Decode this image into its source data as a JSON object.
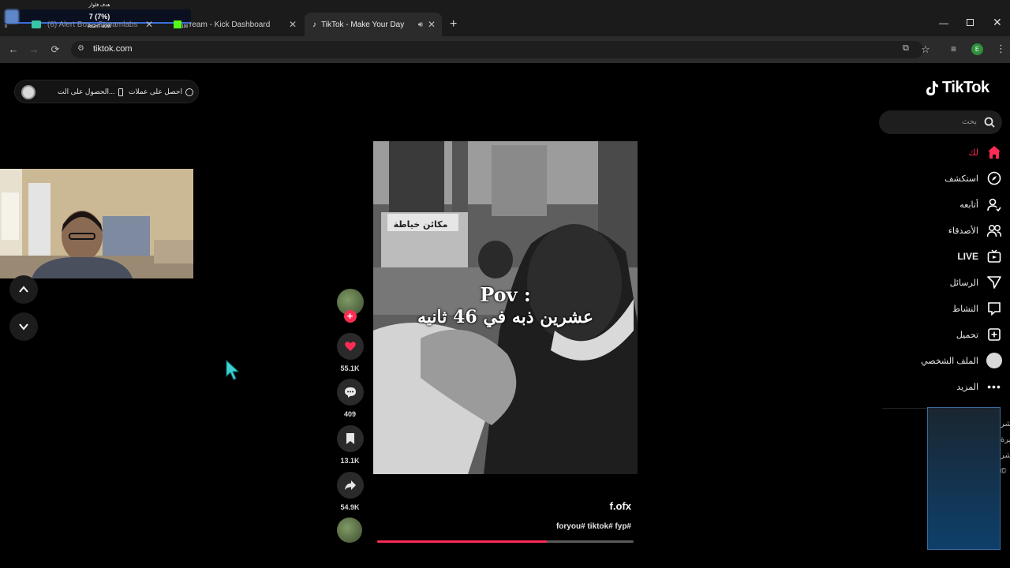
{
  "browser": {
    "tabs": [
      {
        "label": "(6) Alert Box - Streamlabs",
        "active": false
      },
      {
        "label": "ream - Kick Dashboard",
        "active": false
      },
      {
        "label": "TikTok - Make Your Day",
        "active": true
      }
    ],
    "url": "tiktok.com",
    "profile_initial": "E"
  },
  "stream_overlay": {
    "goal_label": "هدف فلوار",
    "goal_value": "7 (7%)",
    "right_now_label": "RIGHT NOW",
    "goal_min": "0",
    "goal_max": "100"
  },
  "tiktok": {
    "logo": "TikTok",
    "search_placeholder": "بحث",
    "nav": [
      {
        "label": "لك",
        "icon": "home-icon",
        "active": true
      },
      {
        "label": "استكشف",
        "icon": "compass-icon",
        "active": false
      },
      {
        "label": "أتابعه",
        "icon": "following-icon",
        "active": false
      },
      {
        "label": "الأصدقاء",
        "icon": "friends-icon",
        "active": false
      },
      {
        "label": "LIVE",
        "icon": "live-icon",
        "active": false
      },
      {
        "label": "الرسائل",
        "icon": "send-icon",
        "active": false
      },
      {
        "label": "النشاط",
        "icon": "message-icon",
        "active": false
      },
      {
        "label": "تحميل",
        "icon": "upload-icon",
        "active": false
      },
      {
        "label": "الملف الشخصي",
        "icon": "profile-avatar-icon",
        "active": false
      },
      {
        "label": "المزيد",
        "icon": "more-icon",
        "active": false
      }
    ],
    "top_pill": {
      "coins_label": "احصل على عملات",
      "app_label": "الحصول على الت..."
    },
    "video": {
      "overlay_line1": "Pov :",
      "overlay_line2": "عشرين ذبه في 46 ثانيه",
      "shop_sign": "مكائن خياطة",
      "author": "f.ofx",
      "caption": "foryou# tiktok# fyp#",
      "progress": 0.66
    },
    "actions": {
      "likes": "55.1K",
      "comments": "409",
      "saves": "13.1K",
      "shares": "54.9K"
    }
  },
  "colors": {
    "accent": "#fe2c55",
    "chrome_bg": "#1b1b1b",
    "panel_border": "#3a6c9a"
  }
}
